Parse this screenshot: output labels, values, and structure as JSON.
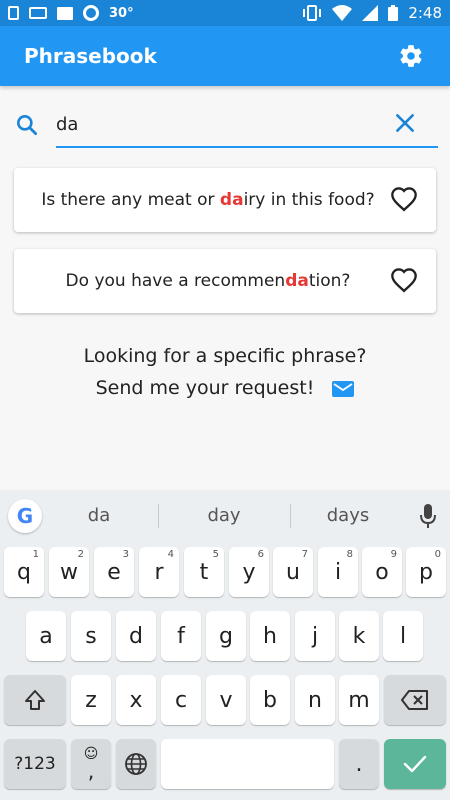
{
  "status": {
    "temperature": "30°",
    "time": "2:48",
    "icons": [
      "sim-icon",
      "keyboard-icon",
      "image-icon",
      "record-icon",
      "vibrate-icon",
      "wifi-icon",
      "signal-icon",
      "battery-icon"
    ]
  },
  "appbar": {
    "title": "Phrasebook",
    "settings_icon": "gear-icon",
    "color": "#2196f3"
  },
  "search": {
    "value": "da",
    "icon": "search-icon",
    "clear_icon": "close-icon"
  },
  "results": [
    {
      "before": "Is there any meat or ",
      "match": "da",
      "after": "iry in this food?",
      "icon": "heart-outline-icon"
    },
    {
      "before": "Do you have a recommen",
      "match": "da",
      "after": "tion?",
      "icon": "heart-outline-icon"
    }
  ],
  "request": {
    "line1": "Looking for a specific phrase?",
    "line2": "Send me your request!",
    "icon": "mail-icon"
  },
  "keyboard": {
    "suggestions": [
      "da",
      "day",
      "days"
    ],
    "row1": [
      {
        "k": "q",
        "h": "1"
      },
      {
        "k": "w",
        "h": "2"
      },
      {
        "k": "e",
        "h": "3"
      },
      {
        "k": "r",
        "h": "4"
      },
      {
        "k": "t",
        "h": "5"
      },
      {
        "k": "y",
        "h": "6"
      },
      {
        "k": "u",
        "h": "7"
      },
      {
        "k": "i",
        "h": "8"
      },
      {
        "k": "o",
        "h": "9"
      },
      {
        "k": "p",
        "h": "0"
      }
    ],
    "row2": [
      "a",
      "s",
      "d",
      "f",
      "g",
      "h",
      "j",
      "k",
      "l"
    ],
    "row3": [
      "z",
      "x",
      "c",
      "v",
      "b",
      "n",
      "m"
    ],
    "symbols_label": "?123",
    "comma": ",",
    "period": ".",
    "accent_color": "#5cb79a"
  }
}
